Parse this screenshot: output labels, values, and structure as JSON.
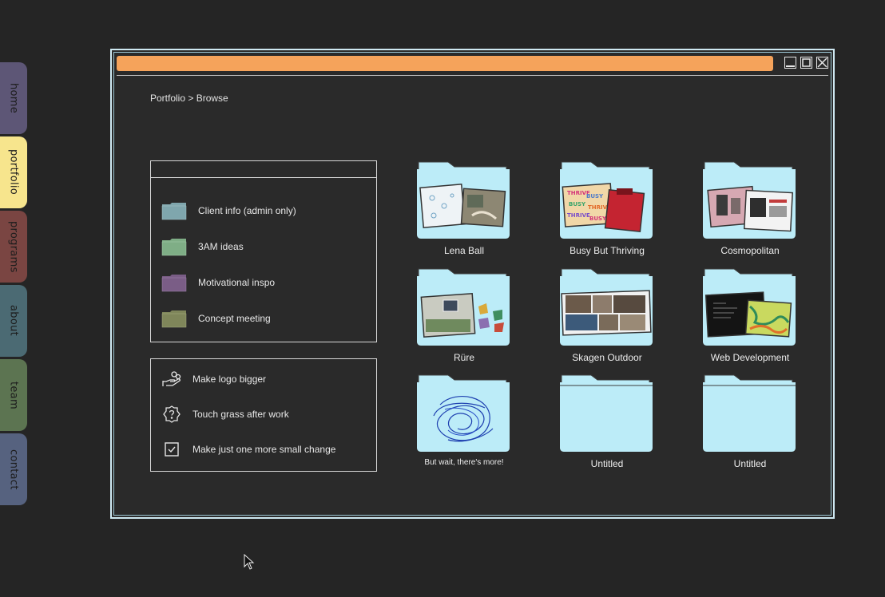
{
  "side_tabs": [
    {
      "label": "home",
      "color": "#5d5676"
    },
    {
      "label": "portfolio",
      "color": "#f7e58d"
    },
    {
      "label": "programs",
      "color": "#7a4542"
    },
    {
      "label": "about",
      "color": "#4b6a73"
    },
    {
      "label": "team",
      "color": "#5c7451"
    },
    {
      "label": "contact",
      "color": "#56627f"
    }
  ],
  "window": {
    "titlebar_color": "#f5a35b",
    "border_color": "#cfe9f2"
  },
  "breadcrumb": "Portfolio > Browse",
  "folders_panel": {
    "items": [
      {
        "label": "Client info (admin only)",
        "color": "#7fa6ad"
      },
      {
        "label": "3AM ideas",
        "color": "#7fae86"
      },
      {
        "label": "Motivational inspo",
        "color": "#7a5d86"
      },
      {
        "label": "Concept meeting",
        "color": "#7f865a"
      }
    ]
  },
  "tasks_panel": {
    "items": [
      {
        "label": "Make logo bigger",
        "icon": "hand-coins-icon"
      },
      {
        "label": "Touch grass after work",
        "icon": "question-badge-icon"
      },
      {
        "label": "Make just one more small change",
        "icon": "checkbox-icon"
      }
    ]
  },
  "projects": {
    "folder_color": "#bcecf8",
    "items": [
      {
        "label": "Lena Ball"
      },
      {
        "label": "Busy But Thriving"
      },
      {
        "label": "Cosmopolitan"
      },
      {
        "label": "Rüre"
      },
      {
        "label": "Skagen Outdoor"
      },
      {
        "label": "Web Development"
      },
      {
        "label": "But wait, there's more!"
      },
      {
        "label": "Untitled"
      },
      {
        "label": "Untitled"
      }
    ]
  }
}
